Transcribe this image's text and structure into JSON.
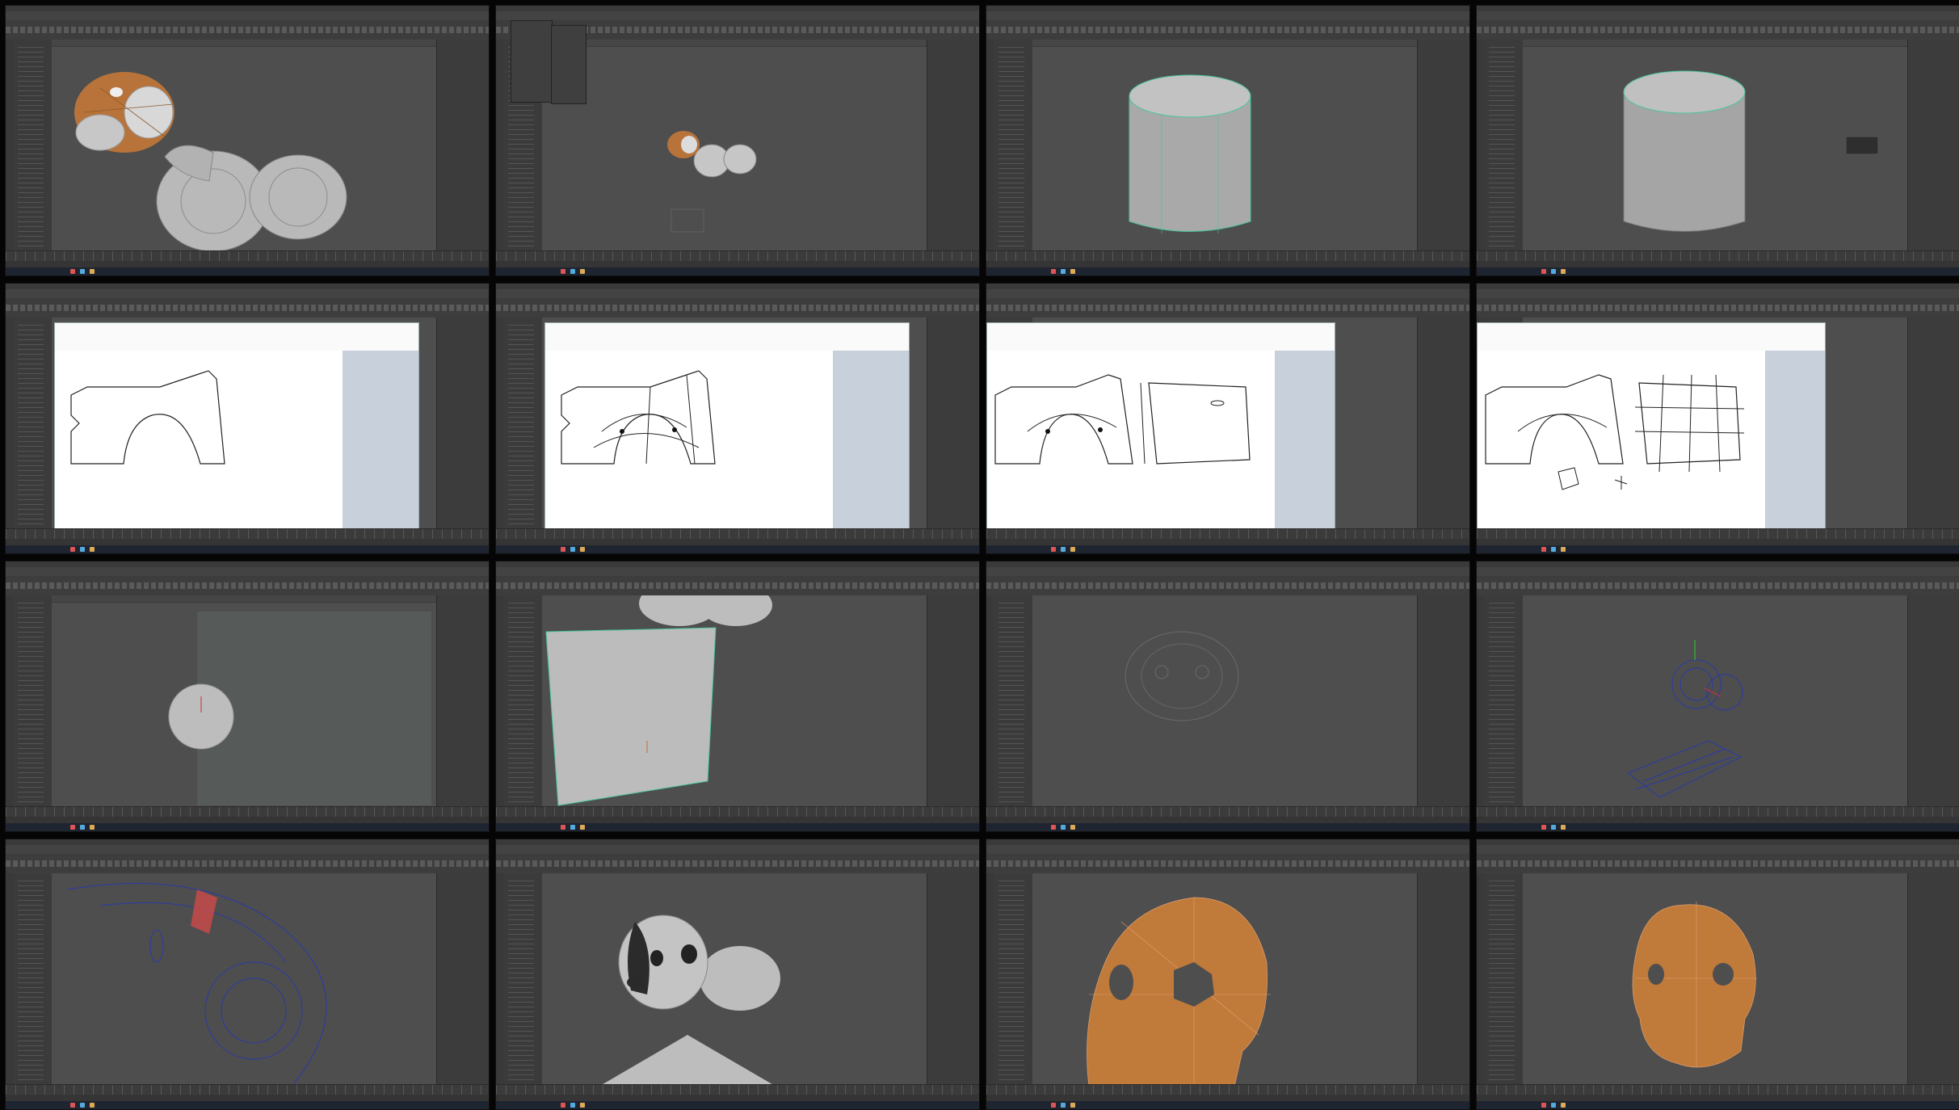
{
  "title": "",
  "layout": {
    "rows": 4,
    "cols": 4
  },
  "colors": {
    "background": "#050505",
    "ui_panel": "#3c3c3c",
    "viewport": "#4e4e4e",
    "model_grey": "#b4b4b4",
    "model_orange": "#c07a3a",
    "wireframe_blue": "#2a3aa8",
    "selection_green": "#49c4a0",
    "taskbar": "#1f2530"
  },
  "frames": [
    {
      "id": 1,
      "content": "dog-model-shaded"
    },
    {
      "id": 2,
      "content": "dog-model-small-with-menu"
    },
    {
      "id": 3,
      "content": "cylinder"
    },
    {
      "id": 4,
      "content": "cylinder-with-popup"
    },
    {
      "id": 5,
      "content": "paint-sketch-car-outline"
    },
    {
      "id": 6,
      "content": "paint-sketch-car-topology"
    },
    {
      "id": 7,
      "content": "paint-sketch-car-door"
    },
    {
      "id": 8,
      "content": "paint-sketch-car-full-grid"
    },
    {
      "id": 9,
      "content": "sphere"
    },
    {
      "id": 10,
      "content": "plane-and-body"
    },
    {
      "id": 11,
      "content": "ghosted-head-wireframe"
    },
    {
      "id": 12,
      "content": "blue-wireframe-dog"
    },
    {
      "id": 13,
      "content": "wireframe-closeup-red-face"
    },
    {
      "id": 14,
      "content": "dog-head-eyes"
    },
    {
      "id": 15,
      "content": "orange-head-closeup"
    },
    {
      "id": 16,
      "content": "orange-head-front"
    }
  ]
}
